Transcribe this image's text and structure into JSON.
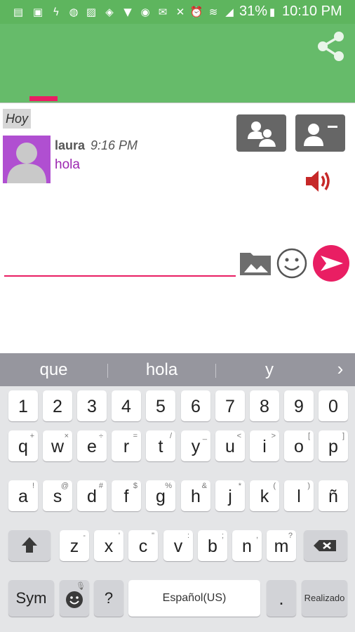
{
  "status_bar": {
    "battery_percent": "31%",
    "time": "10:10 PM",
    "icons": [
      "message-icon",
      "sim-icon",
      "flash-icon",
      "sync-icon",
      "image-icon",
      "shield-icon",
      "lock-icon",
      "gallery-icon",
      "mail-icon",
      "mute-icon",
      "alarm-icon",
      "wifi-icon",
      "signal-icon",
      "battery-icon"
    ]
  },
  "toolbar": {
    "share_icon": "share-icon",
    "accent_color": "#66bb6a",
    "indicator_color": "#e91e63"
  },
  "chat": {
    "date_label": "Hoy",
    "message": {
      "sender": "laura",
      "time": "9:16 PM",
      "text": "hola"
    },
    "buttons": {
      "group": "group-icon",
      "contact": "contact-card-icon",
      "speaker": "speaker-icon"
    },
    "input": {
      "value": "",
      "placeholder": ""
    }
  },
  "keyboard": {
    "suggestions": [
      "que",
      "hola",
      "y"
    ],
    "row_numbers": [
      "1",
      "2",
      "3",
      "4",
      "5",
      "6",
      "7",
      "8",
      "9",
      "0"
    ],
    "row1": [
      {
        "k": "q",
        "h": "+"
      },
      {
        "k": "w",
        "h": "×"
      },
      {
        "k": "e",
        "h": "÷"
      },
      {
        "k": "r",
        "h": "="
      },
      {
        "k": "t",
        "h": "/"
      },
      {
        "k": "y",
        "h": "_"
      },
      {
        "k": "u",
        "h": "<"
      },
      {
        "k": "i",
        "h": ">"
      },
      {
        "k": "o",
        "h": "["
      },
      {
        "k": "p",
        "h": "]"
      }
    ],
    "row2": [
      {
        "k": "a",
        "h": "!"
      },
      {
        "k": "s",
        "h": "@"
      },
      {
        "k": "d",
        "h": "#"
      },
      {
        "k": "f",
        "h": "$"
      },
      {
        "k": "g",
        "h": "%"
      },
      {
        "k": "h",
        "h": "&"
      },
      {
        "k": "j",
        "h": "*"
      },
      {
        "k": "k",
        "h": "("
      },
      {
        "k": "l",
        "h": ")"
      },
      {
        "k": "ñ",
        "h": ""
      }
    ],
    "row3": [
      {
        "k": "z",
        "h": "-"
      },
      {
        "k": "x",
        "h": "'"
      },
      {
        "k": "c",
        "h": "\""
      },
      {
        "k": "v",
        "h": ":"
      },
      {
        "k": "b",
        "h": ";"
      },
      {
        "k": "n",
        "h": ","
      },
      {
        "k": "m",
        "h": "?"
      }
    ],
    "sym_label": "Sym",
    "question_label": "?",
    "space_label": "Español(US)",
    "period_label": ".",
    "done_label": "Realizado"
  }
}
